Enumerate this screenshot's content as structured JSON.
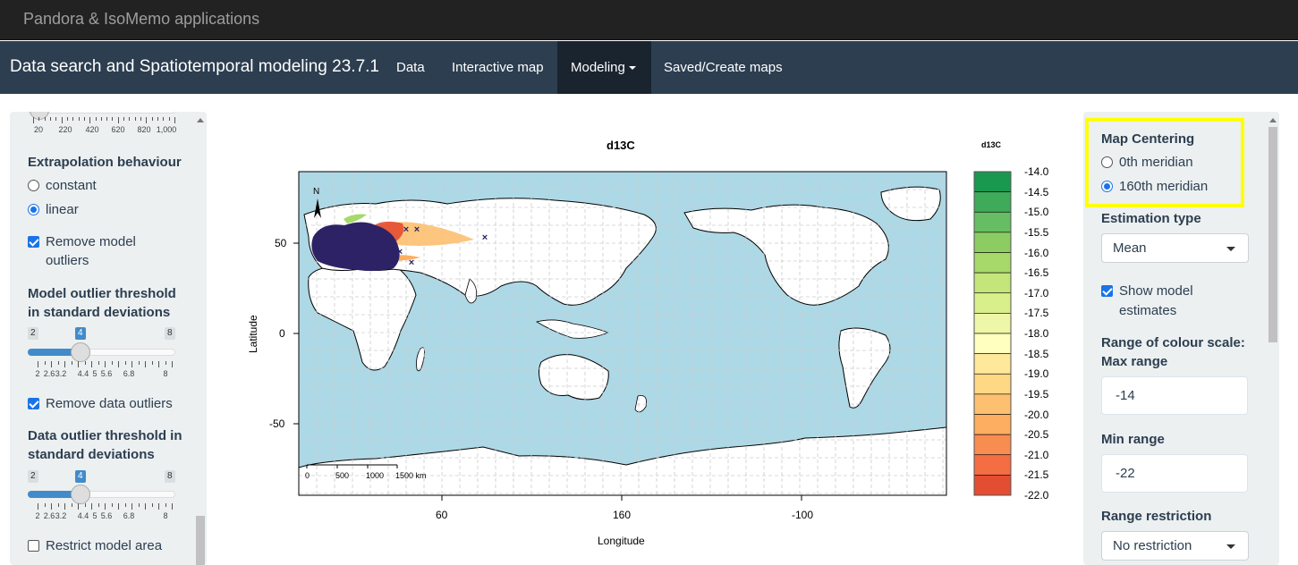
{
  "header": {
    "brand": "Pandora & IsoMemo applications",
    "app_title": "Data search and Spatiotemporal modeling 23.7.1",
    "nav": [
      {
        "label": "Data",
        "active": false
      },
      {
        "label": "Interactive map",
        "active": false
      },
      {
        "label": "Modeling",
        "active": true,
        "dropdown": true
      },
      {
        "label": "Saved/Create maps",
        "active": false
      }
    ]
  },
  "left_panel": {
    "top_slider_ticks": [
      "20",
      "220",
      "420",
      "620",
      "820",
      "1,000"
    ],
    "extrapolation": {
      "label": "Extrapolation behaviour",
      "options": [
        {
          "label": "constant",
          "selected": false
        },
        {
          "label": "linear",
          "selected": true
        }
      ]
    },
    "remove_model_outliers": {
      "label_line1": "Remove model",
      "label_line2": "outliers",
      "checked": true
    },
    "model_outlier_threshold": {
      "label_line1": "Model outlier threshold",
      "label_line2": "in standard deviations",
      "min": "2",
      "max": "8",
      "value": "4",
      "tick_labels": [
        "2",
        "2.6",
        "3.2",
        "4.4",
        "5",
        "5.6",
        "6.8",
        "8"
      ]
    },
    "remove_data_outliers": {
      "label": "Remove data outliers",
      "checked": true
    },
    "data_outlier_threshold": {
      "label_line1": "Data outlier threshold in",
      "label_line2": "standard deviations",
      "min": "2",
      "max": "8",
      "value": "4",
      "tick_labels": [
        "2",
        "2.6",
        "3.2",
        "4.4",
        "5",
        "5.6",
        "6.8",
        "8"
      ]
    },
    "restrict_model_area": {
      "label": "Restrict model area",
      "checked": false
    }
  },
  "right_panel": {
    "map_centering": {
      "label": "Map Centering",
      "options": [
        {
          "label": "0th meridian",
          "selected": false
        },
        {
          "label": "160th meridian",
          "selected": true
        }
      ]
    },
    "estimation_type": {
      "label": "Estimation type",
      "value": "Mean"
    },
    "show_model_estimates": {
      "label_line1": "Show model",
      "label_line2": "estimates",
      "checked": true
    },
    "colour_scale": {
      "label_line1": "Range of colour scale:",
      "label_line2": "Max range",
      "max_value": "-14",
      "min_label": "Min range",
      "min_value": "-22"
    },
    "range_restriction": {
      "label": "Range restriction",
      "value": "No restriction"
    }
  },
  "chart_data": {
    "type": "heatmap",
    "title": "d13C",
    "xlabel": "Longitude",
    "ylabel": "Latitude",
    "x_ticks": [
      "60",
      "160",
      "-100"
    ],
    "y_ticks": [
      "50",
      "0",
      "-50"
    ],
    "map_center_longitude": 160,
    "scale_bar_labels": [
      "0",
      "500",
      "1000",
      "1500 km"
    ],
    "north_arrow": "N",
    "legend": {
      "title": "d13C",
      "labels": [
        "-14.0",
        "-14.5",
        "-15.0",
        "-15.5",
        "-16.0",
        "-16.5",
        "-17.0",
        "-17.5",
        "-18.0",
        "-18.5",
        "-19.0",
        "-19.5",
        "-20.0",
        "-20.5",
        "-21.0",
        "-21.5",
        "-22.0"
      ],
      "colors": [
        "#1a9850",
        "#3eaa5a",
        "#66bd63",
        "#8ccc62",
        "#a6d96a",
        "#c4e57a",
        "#d9ef8b",
        "#eef7a8",
        "#ffffbf",
        "#fee89a",
        "#fed884",
        "#fdc070",
        "#fdae61",
        "#f88d52",
        "#f46d43",
        "#e34d32",
        "#d73027"
      ]
    },
    "colors": {
      "ocean": "#add8e6",
      "land": "#ffffff",
      "data_points": "#2d2266"
    }
  }
}
